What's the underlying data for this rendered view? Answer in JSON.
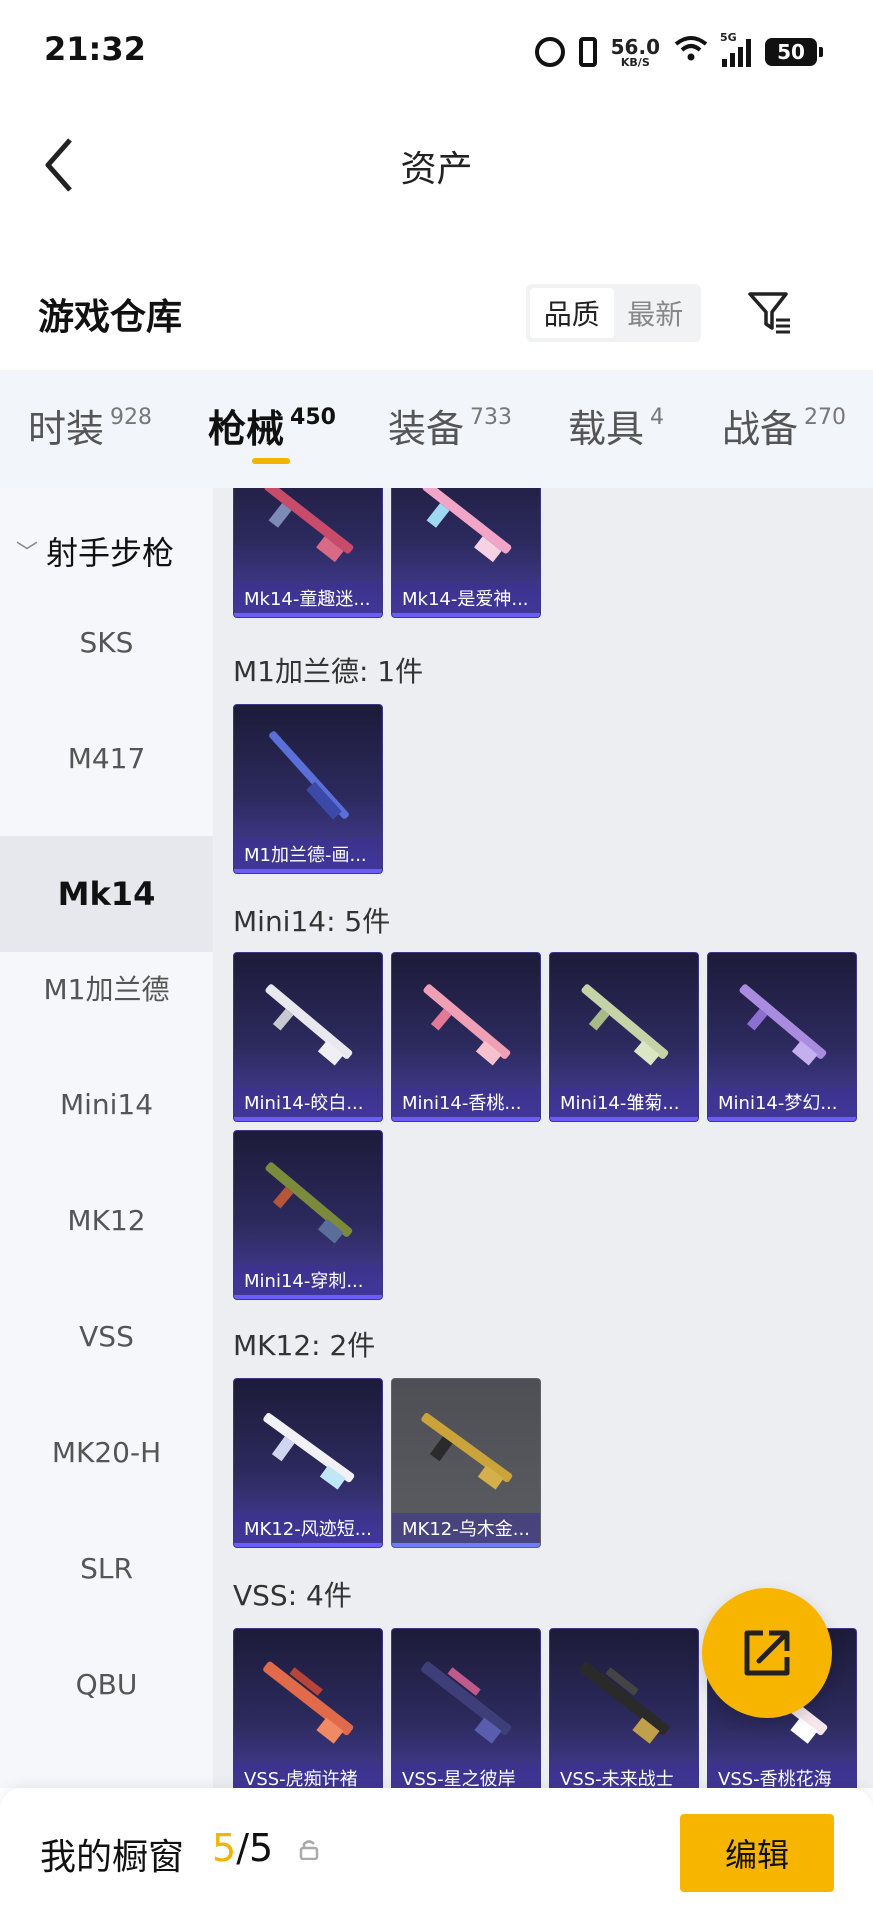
{
  "status": {
    "time": "21:32",
    "net_speed": "56.0",
    "net_unit": "KB/S",
    "network_type": "5G",
    "battery": "50"
  },
  "header": {
    "title": "资产"
  },
  "section": {
    "title": "游戏仓库",
    "sort_options": [
      "品质",
      "最新"
    ],
    "sort_active": "品质"
  },
  "tabs": [
    {
      "label": "时装",
      "count": "928"
    },
    {
      "label": "枪械",
      "count": "450"
    },
    {
      "label": "装备",
      "count": "733"
    },
    {
      "label": "载具",
      "count": "4"
    },
    {
      "label": "战备",
      "count": "270"
    }
  ],
  "active_tab": "枪械",
  "sidebar": {
    "category": "射手步枪",
    "items": [
      "SKS",
      "M417",
      "Mk14",
      "M1加兰德",
      "Mini14",
      "MK12",
      "VSS",
      "MK20-H",
      "SLR",
      "QBU"
    ],
    "active": "Mk14"
  },
  "groups": [
    {
      "label": "",
      "items": [
        "Mk14-童趣迷...",
        "Mk14-是爱神..."
      ]
    },
    {
      "label": "M1加兰德: 1件",
      "items": [
        "M1加兰德-画..."
      ]
    },
    {
      "label": "Mini14: 5件",
      "items": [
        "Mini14-皎白...",
        "Mini14-香桃...",
        "Mini14-雏菊...",
        "Mini14-梦幻...",
        "Mini14-穿刺..."
      ]
    },
    {
      "label": "MK12: 2件",
      "items": [
        "MK12-风迹短...",
        "MK12-乌木金..."
      ]
    },
    {
      "label": "VSS: 4件",
      "items": [
        "VSS-虎痴许褚",
        "VSS-星之彼岸",
        "VSS-未来战士",
        "VSS-香桃花海"
      ]
    }
  ],
  "bottom": {
    "window_label": "我的橱窗",
    "current": "5",
    "separator": "/",
    "max": "5",
    "edit_label": "编辑"
  },
  "colors": {
    "accent": "#f7b500",
    "card_purple": "#2c2a5e",
    "card_grey": "#5c5c63"
  }
}
